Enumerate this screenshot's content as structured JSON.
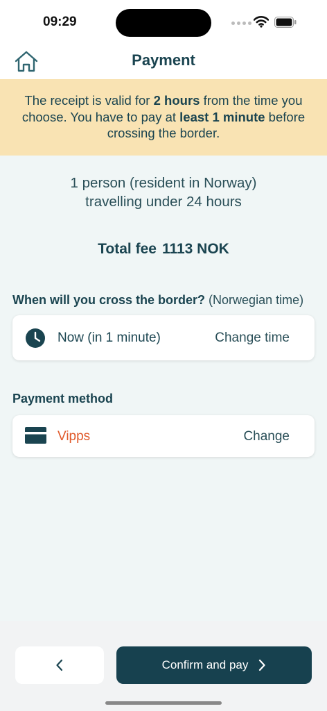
{
  "status_bar": {
    "time": "09:29"
  },
  "header": {
    "title": "Payment"
  },
  "notice": {
    "part1": "The receipt is valid for ",
    "bold1": "2 hours",
    "part2": " from the time you choose. You have to pay at ",
    "bold2": "least 1 minute",
    "part3": " before crossing the border."
  },
  "summary": {
    "line1": "1 person (resident in Norway)",
    "line2": "travelling under 24 hours"
  },
  "total": {
    "label": "Total fee",
    "amount": "1113 NOK"
  },
  "crossing": {
    "question": "When will you cross the border?",
    "note": " (Norwegian time)",
    "value": "Now (in 1 minute)",
    "action": "Change time",
    "icon": "clock-icon"
  },
  "payment": {
    "label": "Payment method",
    "value": "Vipps",
    "value_color": "#e0592a",
    "action": "Change",
    "icon": "credit-card-icon"
  },
  "footer": {
    "confirm_label": "Confirm and pay",
    "primary_color": "#17414f"
  }
}
